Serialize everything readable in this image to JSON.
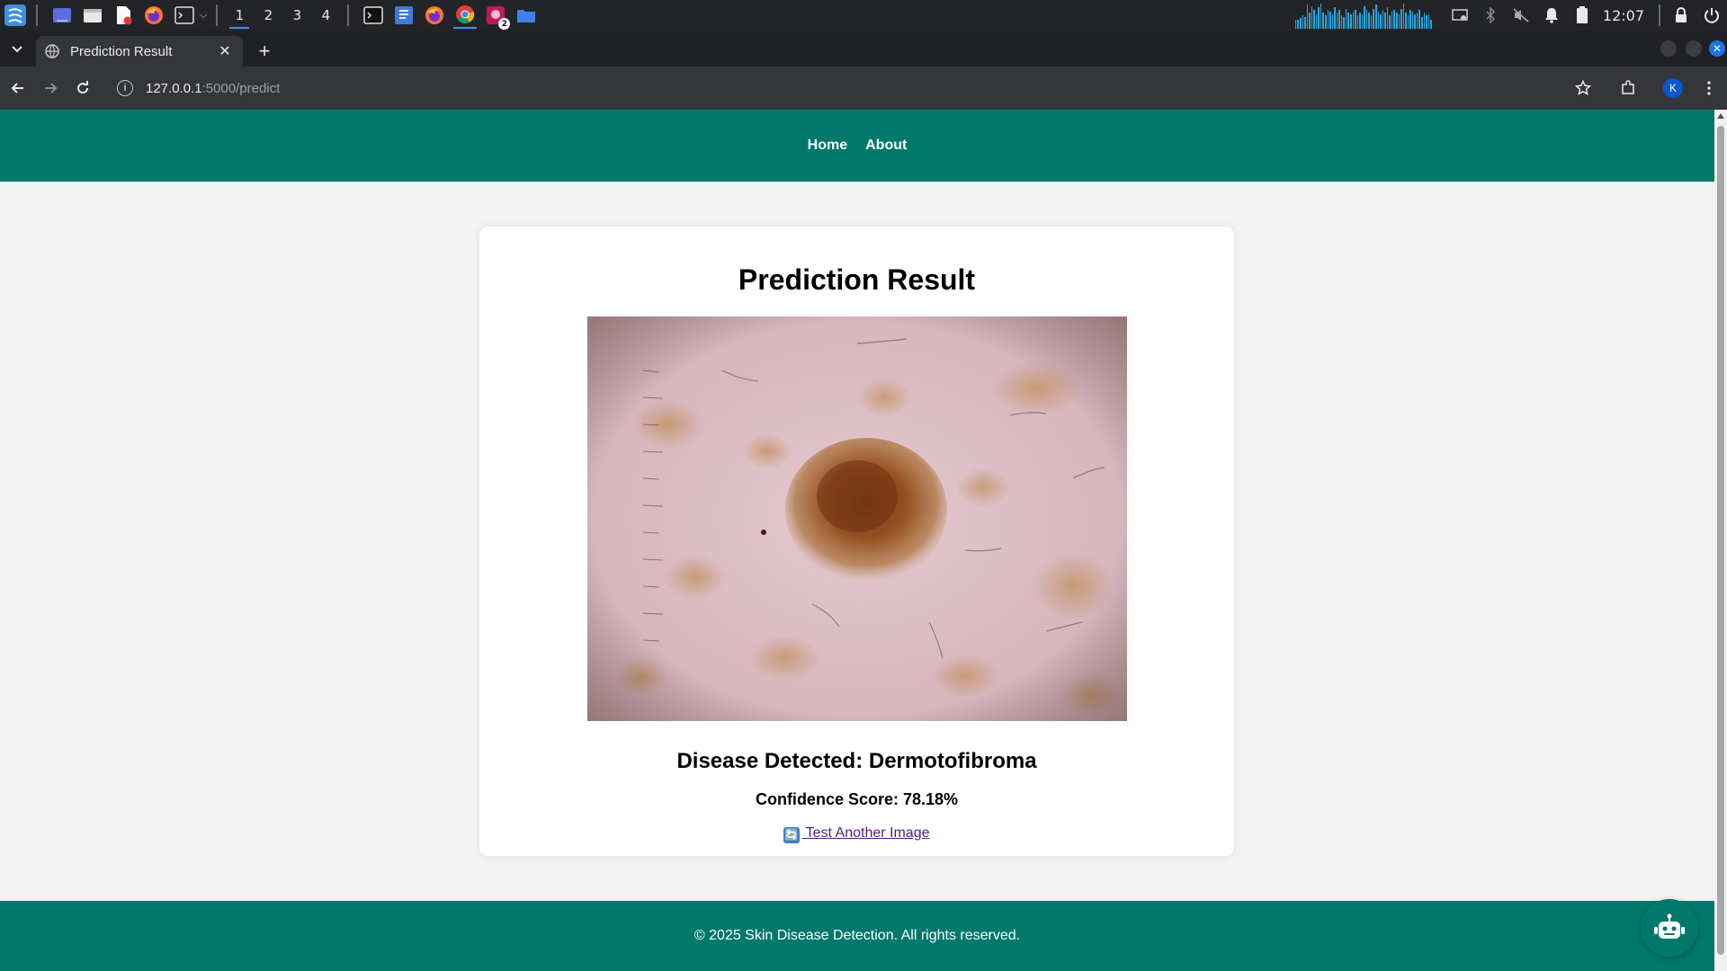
{
  "taskbar": {
    "workspaces": [
      "1",
      "2",
      "3",
      "4"
    ],
    "active_workspace": "1",
    "clock": "12:07",
    "notification_badge": "2",
    "cpu_graph": [
      0.35,
      0.35,
      0.4,
      0.5,
      0.45,
      0.9,
      0.6,
      0.85,
      0.7,
      0.55,
      0.8,
      0.95,
      0.6,
      0.5,
      0.7,
      0.65,
      0.55,
      0.8,
      0.6,
      0.7,
      0.5,
      0.45,
      0.75,
      0.6,
      0.55,
      0.65,
      0.7,
      0.5,
      0.6,
      0.55,
      0.85,
      0.7,
      0.6,
      0.5,
      0.75,
      0.9,
      0.65,
      0.55,
      0.7,
      0.6,
      0.8,
      0.5,
      0.65,
      0.7,
      0.6,
      0.55,
      0.75,
      0.95,
      0.6,
      0.5,
      0.7,
      0.65,
      0.55,
      0.6,
      0.7,
      0.45,
      0.6,
      0.5,
      0.55,
      0.35
    ]
  },
  "browser": {
    "tab_title": "Prediction Result",
    "url_host": "127.0.0.1",
    "url_path": ":5000/predict",
    "profile_initial": "K"
  },
  "page": {
    "nav": {
      "home": "Home",
      "about": "About"
    },
    "heading": "Prediction Result",
    "disease_label": "Disease Detected: Dermotofibroma",
    "confidence_label": "Confidence Score: 78.18%",
    "retry_icon": "🔄",
    "retry_link": "Test Another Image",
    "footer": "© 2025 Skin Disease Detection. All rights reserved.",
    "colors": {
      "primary": "#00796b",
      "background": "#f3f3f3",
      "card": "#ffffff",
      "link": "#551a8b"
    }
  },
  "icons": {
    "taskbar": [
      "app-menu-icon",
      "desktop-icon",
      "file-manager-icon",
      "document-viewer-icon",
      "firefox-icon",
      "terminal-icon",
      "terminal-icon",
      "text-editor-icon",
      "firefox-icon",
      "chrome-icon",
      "image-viewer-icon",
      "folder-icon"
    ],
    "tray": [
      "screen-icon",
      "bluetooth-icon",
      "mute-icon",
      "bell-icon",
      "battery-icon",
      "lock-icon",
      "power-icon"
    ],
    "browser": [
      "back-icon",
      "forward-icon",
      "reload-icon",
      "site-info-icon",
      "star-icon",
      "extensions-icon",
      "menu-icon"
    ],
    "page": [
      "refresh-icon",
      "chatbot-icon"
    ]
  }
}
